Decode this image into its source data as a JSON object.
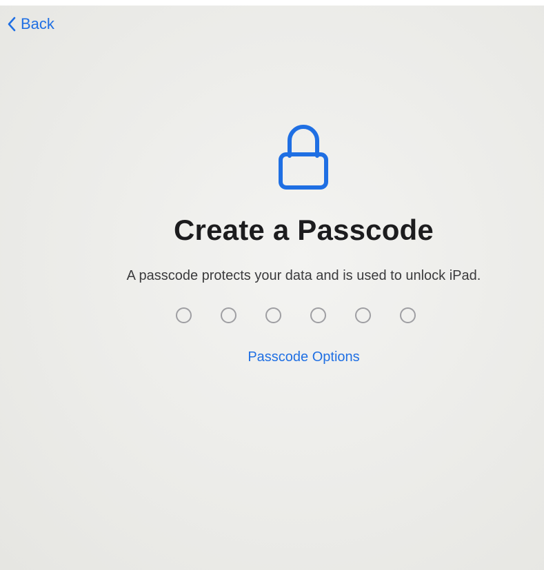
{
  "nav": {
    "back_label": "Back",
    "back_icon": "chevron-left-icon"
  },
  "header": {
    "icon": "lock-icon",
    "title": "Create a Passcode",
    "subtitle": "A passcode protects your data and is used to unlock iPad."
  },
  "passcode": {
    "digits_total": 6,
    "digits_entered": 0
  },
  "options_link_label": "Passcode Options",
  "colors": {
    "accent": "#1f6fe3",
    "dot_border": "#9e9ea2",
    "background": "#ecece9"
  }
}
